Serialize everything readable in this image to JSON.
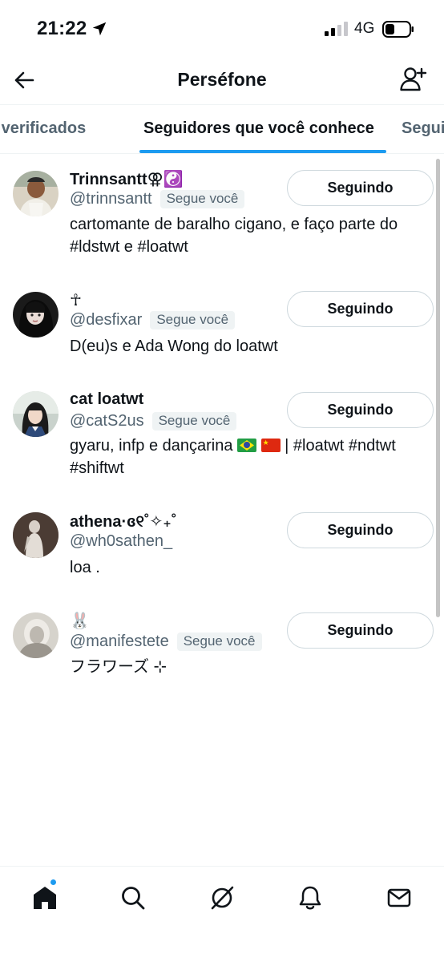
{
  "status_bar": {
    "time": "21:22",
    "network": "4G"
  },
  "header": {
    "title": "Perséfone"
  },
  "tabs": [
    {
      "label": "res verificados"
    },
    {
      "label": "Seguidores que você conhece"
    },
    {
      "label": "Segui"
    }
  ],
  "users": [
    {
      "name": "Trinnsantt",
      "name_suffix": "⚢☯️",
      "handle": "@trinnsantt",
      "badge": "Segue você",
      "bio_line1": "cartomante de baralho cigano, e faço parte do",
      "bio_line2": "#ldstwt e #loatwt",
      "button": "Seguindo"
    },
    {
      "name": "☥",
      "handle": "@desfixar",
      "badge": "Segue você",
      "bio_line1": "D(eu)s e Ada Wong do loatwt",
      "button": "Seguindo"
    },
    {
      "name": "cat loatwt",
      "handle": "@catS2us",
      "badge": "Segue você",
      "bio_pre": "gyaru, infp e dançarina ",
      "bio_post": " | #loatwt #ndtwt",
      "bio_line2": "#shiftwt",
      "button": "Seguindo"
    },
    {
      "name": "athena·ɞ୧˚✧₊˚",
      "handle": "@wh0sathen_",
      "bio_line1": "loa .",
      "button": "Seguindo"
    },
    {
      "name": "🐰",
      "handle": "@manifestete",
      "badge": "Segue você",
      "bio_line1": " フラワーズ ⊹",
      "button": "Seguindo"
    }
  ],
  "colors": {
    "accent": "#1d9bf0",
    "text": "#0f1419",
    "muted": "#536471",
    "badge_bg": "#eff3f4"
  }
}
